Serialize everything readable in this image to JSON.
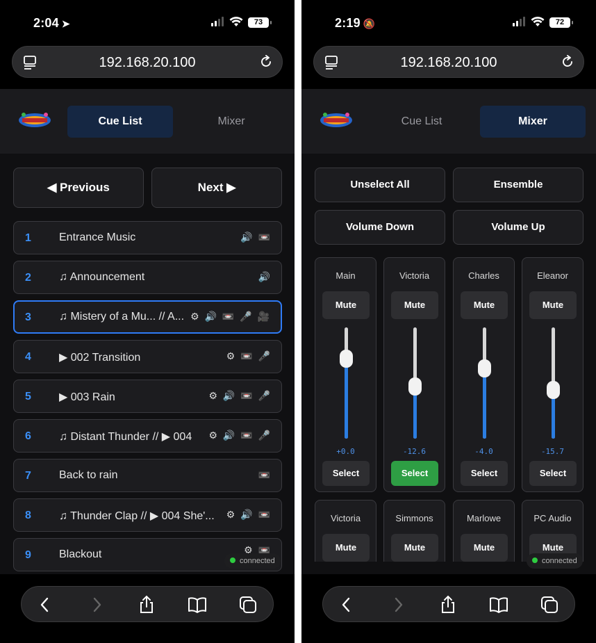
{
  "left": {
    "status": {
      "time": "2:04",
      "time_glyph": "➤",
      "battery": "73"
    },
    "url": "192.168.20.100",
    "tabs": {
      "cue_list": "Cue List",
      "mixer": "Mixer"
    },
    "nav": {
      "previous": "◀ Previous",
      "next": "Next ▶"
    },
    "cues": [
      {
        "num": "1",
        "name": "Entrance Music",
        "icons": "🔊 📼"
      },
      {
        "num": "2",
        "name": "♫ Announcement",
        "icons": "🔊"
      },
      {
        "num": "3",
        "name": "♫ Mistery of a Mu... // A...",
        "icons": "⚙ 🔊 📼 🎤 🎥"
      },
      {
        "num": "4",
        "name": "▶ 002 Transition",
        "icons": "⚙ 📼 🎤"
      },
      {
        "num": "5",
        "name": "▶ 003 Rain",
        "icons": "⚙ 🔊 📼 🎤"
      },
      {
        "num": "6",
        "name": "♫ Distant Thunder // ▶ 004",
        "icons": "⚙ 🔊 📼 🎤"
      },
      {
        "num": "7",
        "name": "Back to rain",
        "icons": "📼"
      },
      {
        "num": "8",
        "name": "♫ Thunder Clap // ▶ 004 She'...",
        "icons": "⚙ 🔊 📼"
      },
      {
        "num": "9",
        "name": "Blackout",
        "icons": "⚙ 📼"
      }
    ],
    "connected": "connected"
  },
  "right": {
    "status": {
      "time": "2:19",
      "time_glyph": "🔕",
      "battery": "72"
    },
    "url": "192.168.20.100",
    "tabs": {
      "cue_list": "Cue List",
      "mixer": "Mixer"
    },
    "actions": {
      "unselect_all": "Unselect All",
      "ensemble": "Ensemble",
      "volume_down": "Volume Down",
      "volume_up": "Volume Up"
    },
    "channels": [
      {
        "name": "Main",
        "mute": "Mute",
        "db": "+0.0",
        "select": "Select",
        "level": 0.72,
        "selected": false
      },
      {
        "name": "Victoria",
        "mute": "Mute",
        "db": "-12.6",
        "select": "Select",
        "level": 0.47,
        "selected": true
      },
      {
        "name": "Charles",
        "mute": "Mute",
        "db": "-4.0",
        "select": "Select",
        "level": 0.63,
        "selected": false
      },
      {
        "name": "Eleanor",
        "mute": "Mute",
        "db": "-15.7",
        "select": "Select",
        "level": 0.44,
        "selected": false
      }
    ],
    "channels_row2": [
      {
        "name": "Victoria",
        "mute": "Mute"
      },
      {
        "name": "Simmons",
        "mute": "Mute"
      },
      {
        "name": "Marlowe",
        "mute": "Mute"
      },
      {
        "name": "PC Audio",
        "mute": "Mute"
      }
    ],
    "connected": "connected"
  },
  "colors": {
    "accent_blue": "#2f7bf6",
    "select_green": "#2e9e44",
    "fader_fill": "#2b7de1"
  }
}
